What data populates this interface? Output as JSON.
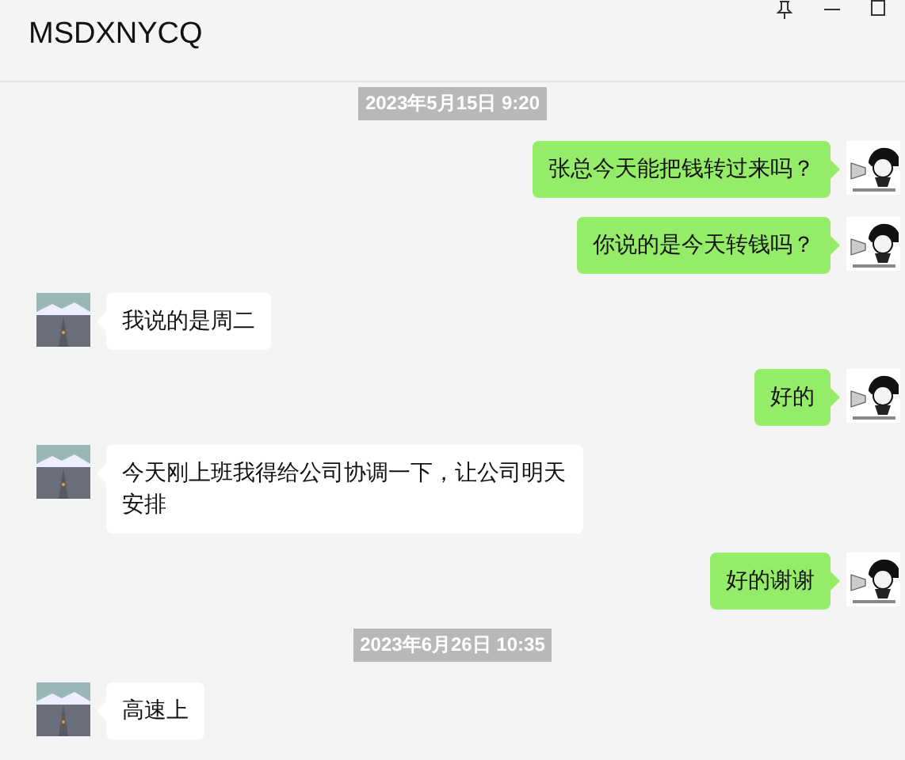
{
  "window": {
    "title": "MSDXNYCQ"
  },
  "messages": [
    {
      "kind": "timestamp",
      "text": "2023年5月15日 9:20"
    },
    {
      "kind": "message",
      "outgoing": true,
      "text": "张总今天能把钱转过来吗？"
    },
    {
      "kind": "message",
      "outgoing": true,
      "text": "你说的是今天转钱吗？"
    },
    {
      "kind": "message",
      "outgoing": false,
      "text": "我说的是周二"
    },
    {
      "kind": "message",
      "outgoing": true,
      "text": "好的"
    },
    {
      "kind": "message",
      "outgoing": false,
      "text": "今天刚上班我得给公司协调一下，让公司明天安排"
    },
    {
      "kind": "message",
      "outgoing": true,
      "text": "好的谢谢"
    },
    {
      "kind": "timestamp",
      "text": "2023年6月26日 10:35"
    },
    {
      "kind": "message",
      "outgoing": false,
      "text": "高速上"
    }
  ]
}
